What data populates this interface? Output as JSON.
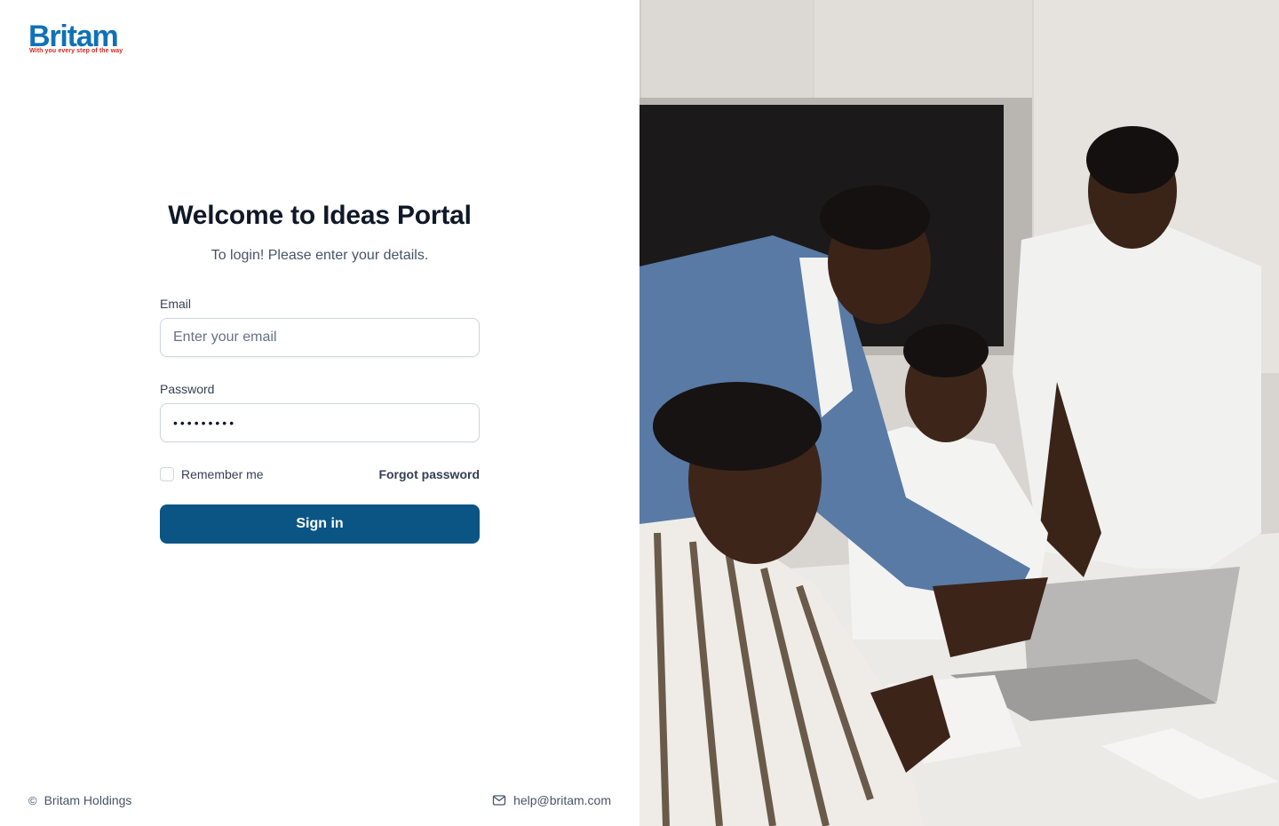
{
  "brand": {
    "name": "Britam",
    "tagline": "With you every step of the way",
    "primary_color": "#0f72b6",
    "tagline_color": "#d6261c",
    "button_color": "#0b5585"
  },
  "login": {
    "title": "Welcome to Ideas Portal",
    "subtitle": "To login! Please enter your details.",
    "email_label": "Email",
    "email_placeholder": "Enter your email",
    "email_value": "",
    "password_label": "Password",
    "password_value": "•••••••••",
    "remember_label": "Remember me",
    "remember_checked": false,
    "forgot_label": "Forgot password",
    "submit_label": "Sign in"
  },
  "footer": {
    "copyright_icon": "copyright-icon",
    "copyright_text": "Britam Holdings",
    "email_icon": "mail-icon",
    "email_text": "help@britam.com"
  },
  "hero": {
    "image_icon": "team-meeting-photo"
  }
}
